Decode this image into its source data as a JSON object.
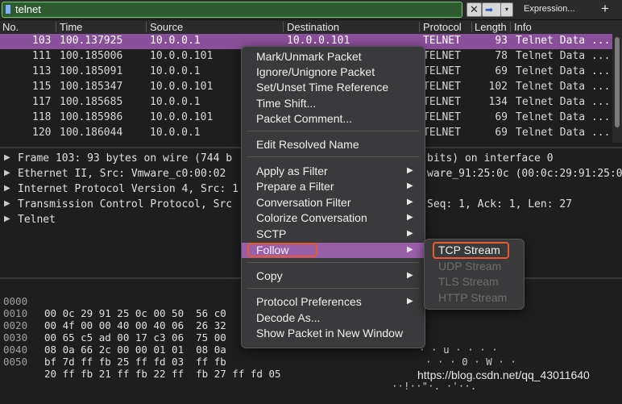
{
  "filter": {
    "text": "telnet",
    "clear_label": "✕",
    "apply_label": "➡",
    "dropdown_label": "▾",
    "expression_label": "Expression...",
    "plus_label": "+"
  },
  "columns": [
    "No.",
    "Time",
    "Source",
    "Destination",
    "Protocol",
    "Length",
    "Info"
  ],
  "packets": [
    {
      "no": "103",
      "time": "100.137925",
      "src": "10.0.0.1",
      "dst": "10.0.0.101",
      "proto": "TELNET",
      "len": "93",
      "info": "Telnet Data ..."
    },
    {
      "no": "111",
      "time": "100.185006",
      "src": "10.0.0.101",
      "dst": "",
      "proto": "TELNET",
      "len": "78",
      "info": "Telnet Data ..."
    },
    {
      "no": "113",
      "time": "100.185091",
      "src": "10.0.0.1",
      "dst": "",
      "proto": "TELNET",
      "len": "69",
      "info": "Telnet Data ..."
    },
    {
      "no": "115",
      "time": "100.185347",
      "src": "10.0.0.101",
      "dst": "",
      "proto": "TELNET",
      "len": "102",
      "info": "Telnet Data ..."
    },
    {
      "no": "117",
      "time": "100.185685",
      "src": "10.0.0.1",
      "dst": "",
      "proto": "TELNET",
      "len": "134",
      "info": "Telnet Data ..."
    },
    {
      "no": "118",
      "time": "100.185986",
      "src": "10.0.0.101",
      "dst": "",
      "proto": "TELNET",
      "len": "69",
      "info": "Telnet Data ..."
    },
    {
      "no": "120",
      "time": "100.186044",
      "src": "10.0.0.1",
      "dst": "",
      "proto": "TELNET",
      "len": "69",
      "info": "Telnet Data ..."
    }
  ],
  "details": [
    {
      "left": "Frame 103: 93 bytes on wire (744 b",
      "right": "bits) on interface 0"
    },
    {
      "left": "Ethernet II, Src: Vmware_c0:00:02",
      "right": "ware_91:25:0c (00:0c:29:91:25:0"
    },
    {
      "left": "Internet Protocol Version 4, Src: 1",
      "right": ""
    },
    {
      "left": "Transmission Control Protocol, Src",
      "right": "Seq: 1, Ack: 1, Len: 27"
    },
    {
      "left": "Telnet",
      "right": ""
    }
  ],
  "hex": [
    {
      "off": "0000",
      "bytes": "00 0c 29 91 25 0c 00 50  56 c0",
      "ascii": ""
    },
    {
      "off": "0010",
      "bytes": "00 4f 00 00 40 00 40 06  26 32",
      "ascii": ""
    },
    {
      "off": "0020",
      "bytes": "00 65 c5 ad 00 17 c3 06  75 00",
      "ascii": "· · u · · · ·"
    },
    {
      "off": "0030",
      "bytes": "08 0a 66 2c 00 00 01 01  08 0a",
      "ascii": "· · · 0 · W · ·"
    },
    {
      "off": "0040",
      "bytes": "bf 7d ff fb 25 ff fd 03  ff fb",
      "ascii": ""
    },
    {
      "off": "0050",
      "bytes": "20 ff fb 21 ff fb 22 ff  fb 27 ff fd 05",
      "ascii": "··!··\"·. ·'··."
    }
  ],
  "menu": {
    "mark": "Mark/Unmark Packet",
    "ignore": "Ignore/Unignore Packet",
    "time_ref": "Set/Unset Time Reference",
    "time_shift": "Time Shift...",
    "comment": "Packet Comment...",
    "edit_resolved": "Edit Resolved Name",
    "apply_filter": "Apply as Filter",
    "prepare_filter": "Prepare a Filter",
    "conversation_filter": "Conversation Filter",
    "colorize": "Colorize Conversation",
    "sctp": "SCTP",
    "follow": "Follow",
    "copy": "Copy",
    "protocol_prefs": "Protocol Preferences",
    "decode_as": "Decode As...",
    "show_new_window": "Show Packet in New Window"
  },
  "submenu": {
    "tcp": "TCP Stream",
    "udp": "UDP Stream",
    "tls": "TLS Stream",
    "http": "HTTP Stream"
  },
  "watermark": "https://blog.csdn.net/qq_43011640"
}
